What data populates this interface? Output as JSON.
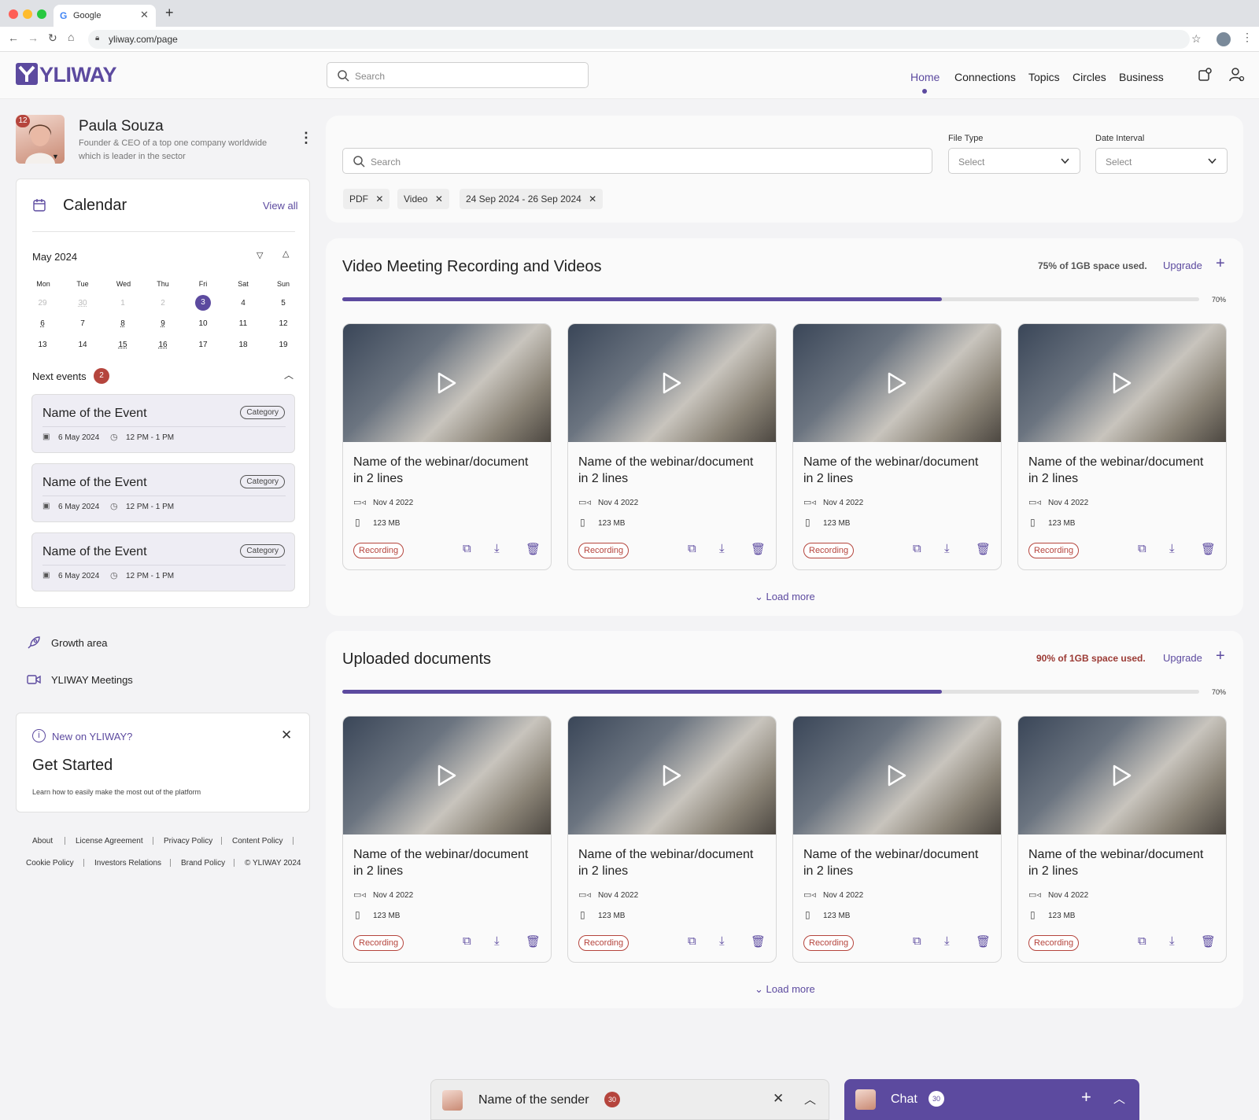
{
  "browser": {
    "tab_title": "Google",
    "url": "yliway.com/page"
  },
  "header": {
    "logo": "YLIWAY",
    "search_placeholder": "Search",
    "nav": [
      "Home",
      "Connections",
      "Topics",
      "Circles",
      "Business"
    ],
    "active_nav": "Home"
  },
  "profile": {
    "name": "Paula Souza",
    "description_line1": "Founder & CEO of a top one company worldwide",
    "description_line2": "which is leader in the sector",
    "notification_count": "12"
  },
  "calendar": {
    "title": "Calendar",
    "view_all": "View all",
    "month": "May 2024",
    "weekdays": [
      "Mon",
      "Tue",
      "Wed",
      "Thu",
      "Fri",
      "Sat",
      "Sun"
    ],
    "weeks": [
      [
        "29",
        "30",
        "1",
        "2",
        "3",
        "4",
        "5"
      ],
      [
        "6",
        "7",
        "8",
        "9",
        "10",
        "11",
        "12"
      ],
      [
        "13",
        "14",
        "15",
        "16",
        "17",
        "18",
        "19"
      ]
    ],
    "selected_day": "3",
    "next_events_label": "Next events",
    "next_events_count": "2",
    "events": [
      {
        "name": "Name of the Event",
        "category": "Category",
        "date": "6 May 2024",
        "time": "12 PM - 1 PM"
      },
      {
        "name": "Name of the Event",
        "category": "Category",
        "date": "6 May 2024",
        "time": "12 PM - 1 PM"
      },
      {
        "name": "Name of the Event",
        "category": "Category",
        "date": "6 May 2024",
        "time": "12 PM - 1 PM"
      }
    ]
  },
  "sidebar_links": {
    "growth": "Growth area",
    "meetings": "YLIWAY Meetings"
  },
  "get_started": {
    "eyebrow": "New on YLIWAY?",
    "title": "Get Started",
    "text": "Learn how to easily make the most out of the platform"
  },
  "footer": {
    "row1": [
      "About",
      "License Agreement",
      "Privacy Policy",
      "Content Policy"
    ],
    "row2": [
      "Cookie Policy",
      "Investors Relations",
      "Brand Policy",
      "© YLIWAY 2024"
    ]
  },
  "filters": {
    "search_placeholder": "Search",
    "file_type_label": "File Type",
    "file_type_value": "Select",
    "date_interval_label": "Date Interval",
    "date_interval_value": "Select",
    "chips": [
      "PDF",
      "Video",
      "24 Sep 2024 - 26 Sep 2024"
    ]
  },
  "videos_section": {
    "title": "Video Meeting Recording and Videos",
    "space_used": "75% of 1GB space used.",
    "upgrade": "Upgrade",
    "progress_label": "70%",
    "progress": 0.7,
    "load_more": "Load more",
    "space_color": "#555555"
  },
  "docs_section": {
    "title": "Uploaded documents",
    "space_used": "90% of 1GB space used.",
    "upgrade": "Upgrade",
    "progress_label": "70%",
    "progress": 0.7,
    "load_more": "Load more",
    "space_color": "#9b3a34"
  },
  "card": {
    "title_line1": "Name of the webinar/document",
    "title_line2": "in 2 lines",
    "date": "Nov 4 2022",
    "size": "123 MB",
    "tag": "Recording"
  },
  "chat": {
    "sender": "Name of the sender",
    "sender_count": "30",
    "chat_label": "Chat",
    "chat_count": "30"
  },
  "colors": {
    "accent": "#5c4a9f",
    "badge": "#b5453d"
  }
}
